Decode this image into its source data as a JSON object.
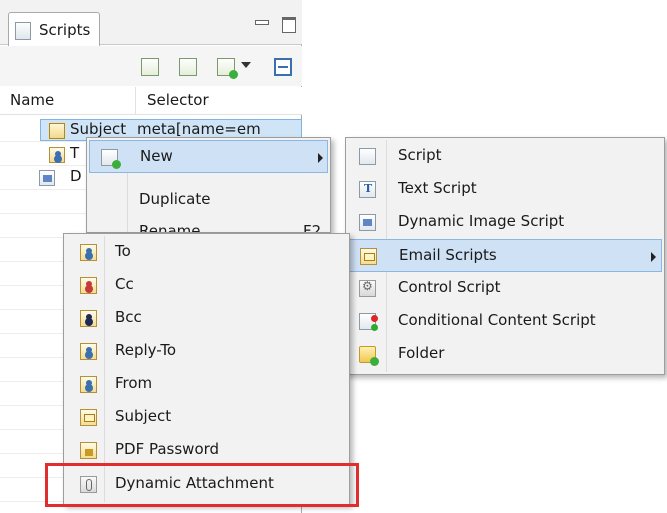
{
  "view": {
    "tab_label": "Scripts",
    "tab_icon": "script-view-icon",
    "toolbar_icons": [
      "new-script-icon",
      "new-text-script-icon",
      "new-script-add-icon",
      "view-menu-dropdown-icon",
      "collapse-all-icon"
    ]
  },
  "table": {
    "columns": [
      "Name",
      "Selector"
    ],
    "rows": [
      {
        "name": "Subject",
        "selector": "meta[name=em"
      },
      {
        "name": "T",
        "selector": ""
      },
      {
        "name": "D",
        "selector": ""
      }
    ]
  },
  "context_menu": {
    "items": [
      {
        "label": "New",
        "icon": "new-icon",
        "has_submenu": true
      },
      {
        "label": "Duplicate",
        "icon": ""
      },
      {
        "label": "Rename",
        "shortcut": "F2",
        "icon": ""
      }
    ]
  },
  "new_submenu": {
    "items": [
      {
        "label": "Script",
        "icon": "script-icon"
      },
      {
        "label": "Text Script",
        "icon": "text-script-icon"
      },
      {
        "label": "Dynamic Image Script",
        "icon": "image-script-icon"
      },
      {
        "label": "Email Scripts",
        "icon": "email-script-icon",
        "has_submenu": true
      },
      {
        "label": "Control Script",
        "icon": "gear-icon"
      },
      {
        "label": "Conditional Content Script",
        "icon": "conditional-icon"
      },
      {
        "label": "Folder",
        "icon": "folder-icon"
      }
    ]
  },
  "email_submenu": {
    "items": [
      {
        "label": "To",
        "icon": "person-icon"
      },
      {
        "label": "Cc",
        "icon": "person-icon"
      },
      {
        "label": "Bcc",
        "icon": "person-icon"
      },
      {
        "label": "Reply-To",
        "icon": "person-icon"
      },
      {
        "label": "From",
        "icon": "person-icon"
      },
      {
        "label": "Subject",
        "icon": "email-icon"
      },
      {
        "label": "PDF Password",
        "icon": "lock-icon"
      },
      {
        "label": "Dynamic Attachment",
        "icon": "attachment-icon"
      }
    ]
  },
  "colors": {
    "highlight_box": "#e02d2d",
    "menu_hover": "#cfe1f5",
    "selection": "#cfe5f7"
  }
}
